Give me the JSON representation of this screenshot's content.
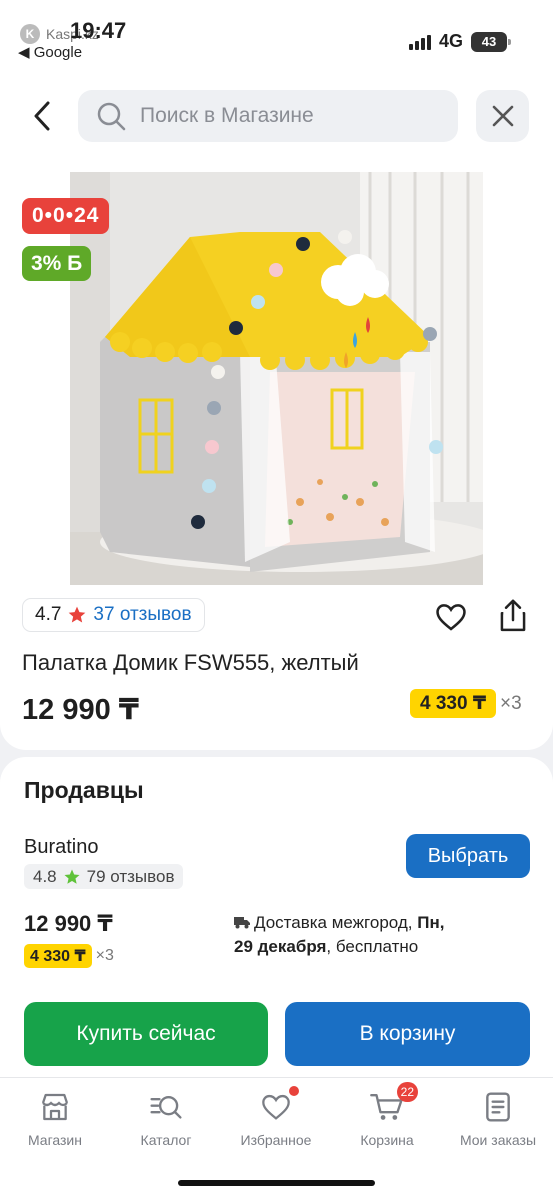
{
  "status_bar": {
    "time": "19:47",
    "app_name": "Kaspi.kz",
    "back_label": "◀ Google",
    "network": "4G",
    "battery": "43"
  },
  "header": {
    "search_placeholder": "Поиск в Магазине"
  },
  "product": {
    "timer": "0•0•24",
    "bonus": "3% Б",
    "rating": "4.7",
    "reviews": "37 отзывов",
    "title": "Палатка Домик FSW555, желтый",
    "price": "12 990 ₸",
    "installment": "4 330 ₸",
    "installment_mult": "×3"
  },
  "sellers": {
    "title": "Продавцы",
    "seller_name": "Buratino",
    "seller_rating": "4.8",
    "seller_reviews": "79 отзывов",
    "choose_label": "Выбрать",
    "price": "12 990 ₸",
    "installment": "4 330 ₸",
    "installment_mult": "×3",
    "delivery_prefix": "Доставка межгород, ",
    "delivery_day": "Пн,",
    "delivery_date": "29 декабря",
    "delivery_suffix": ", бесплатно"
  },
  "actions": {
    "buy_now": "Купить сейчас",
    "to_cart": "В корзину"
  },
  "nav": {
    "items": [
      {
        "label": "Магазин",
        "icon": "store-icon"
      },
      {
        "label": "Каталог",
        "icon": "catalog-icon"
      },
      {
        "label": "Избранное",
        "icon": "heart-icon"
      },
      {
        "label": "Корзина",
        "icon": "cart-icon",
        "badge": "22"
      },
      {
        "label": "Мои заказы",
        "icon": "orders-icon"
      }
    ]
  },
  "colors": {
    "accent_blue": "#1a6fc4",
    "buy_green": "#17a34a",
    "timer_red": "#e8423b",
    "bonus_green": "#5fa928",
    "installment_yellow": "#ffd400"
  }
}
